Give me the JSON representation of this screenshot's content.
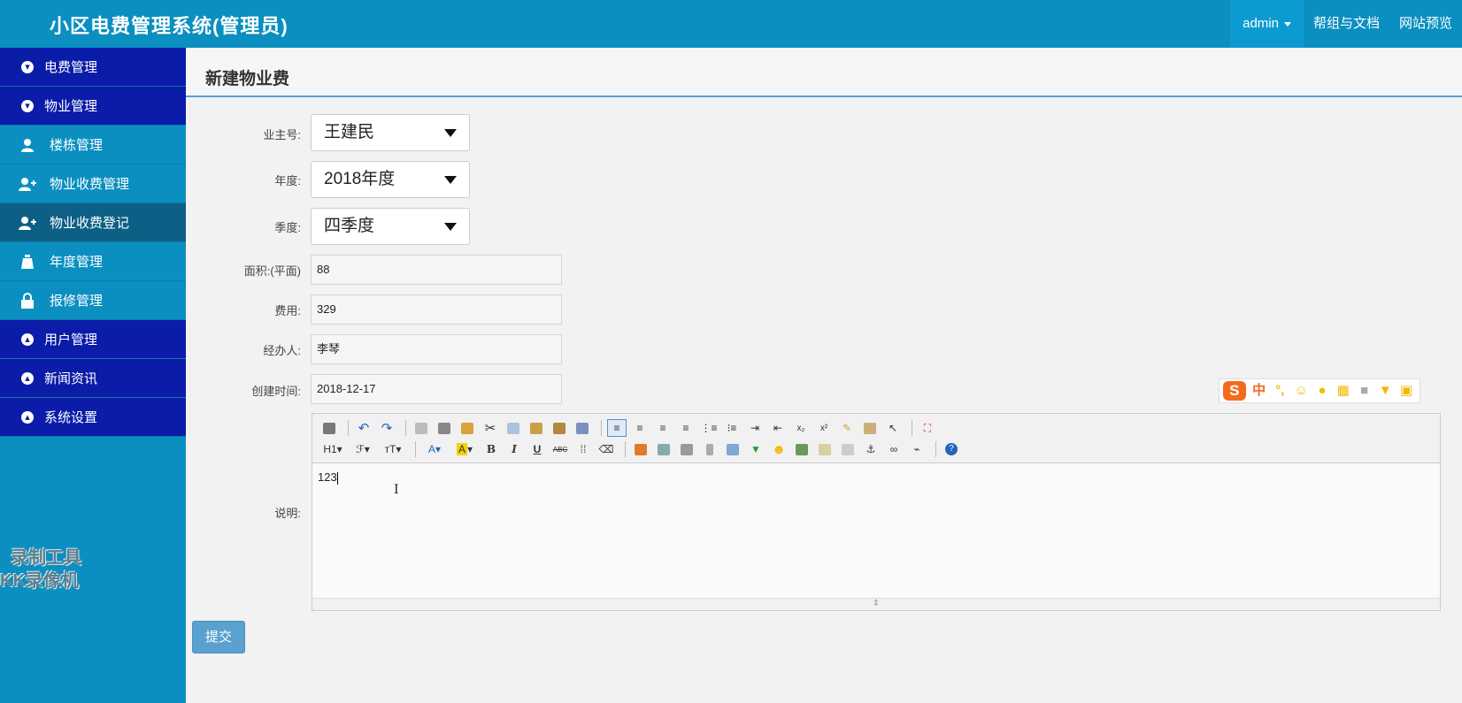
{
  "header": {
    "title": "小区电费管理系统(管理员)",
    "user": "admin",
    "help": "帮组与文档",
    "preview": "网站预览"
  },
  "sidebar": {
    "items": [
      {
        "label": "电费管理",
        "type": "group",
        "icon": "arrow-down-circle-icon"
      },
      {
        "label": "物业管理",
        "type": "group",
        "icon": "arrow-down-circle-icon"
      },
      {
        "label": "楼栋管理",
        "type": "sub",
        "icon": "user-icon"
      },
      {
        "label": "物业收费管理",
        "type": "sub",
        "icon": "user-add-icon"
      },
      {
        "label": "物业收费登记",
        "type": "sub",
        "icon": "user-add-icon",
        "active": true
      },
      {
        "label": "年度管理",
        "type": "sub",
        "icon": "money-bag-icon"
      },
      {
        "label": "报修管理",
        "type": "sub",
        "icon": "lock-icon"
      },
      {
        "label": "用户管理",
        "type": "group",
        "icon": "arrow-up-circle-icon"
      },
      {
        "label": "新闻资讯",
        "type": "group",
        "icon": "arrow-up-circle-icon"
      },
      {
        "label": "系统设置",
        "type": "group",
        "icon": "arrow-up-circle-icon"
      }
    ],
    "watermark_line1": "录制工具",
    "watermark_line2": "KK录像机"
  },
  "page": {
    "title": "新建物业费"
  },
  "form": {
    "owner_label": "业主号:",
    "owner_value": "王建民",
    "year_label": "年度:",
    "year_value": "2018年度",
    "season_label": "季度:",
    "season_value": "四季度",
    "area_label": "面积:(平面)",
    "area_value": "88",
    "fee_label": "费用:",
    "fee_value": "329",
    "handler_label": "经办人:",
    "handler_value": "李琴",
    "created_label": "创建时间:",
    "created_value": "2018-12-17",
    "desc_label": "说明:",
    "desc_value": "123",
    "submit_label": "提交"
  },
  "editor": {
    "heading_btn": "H1",
    "font_btn": "ℱ",
    "size_btn": "тT",
    "bold": "B",
    "italic": "I",
    "underline": "U",
    "strike": "ABC"
  },
  "ime": {
    "logo": "S",
    "mode": "中"
  }
}
